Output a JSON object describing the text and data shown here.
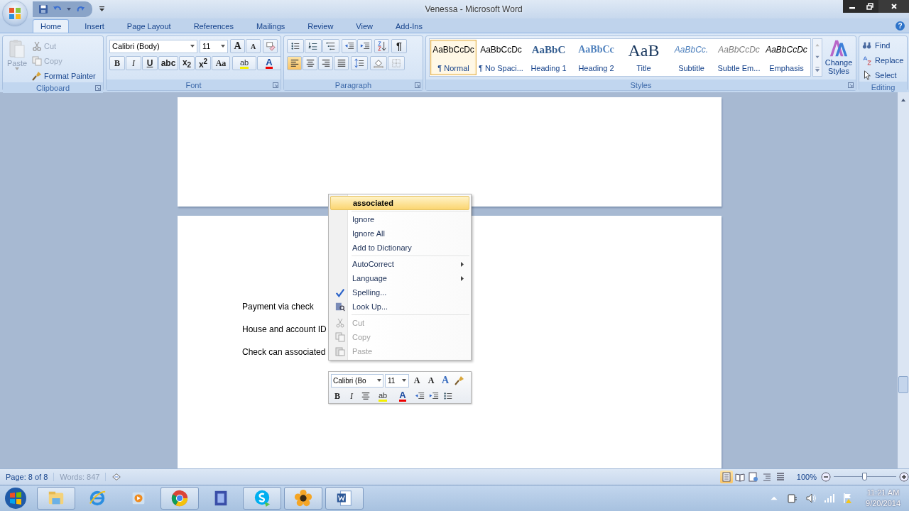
{
  "window": {
    "title": "Venessa - Microsoft Word"
  },
  "tabs": [
    {
      "label": "Home",
      "selected": true
    },
    {
      "label": "Insert",
      "selected": false
    },
    {
      "label": "Page Layout",
      "selected": false
    },
    {
      "label": "References",
      "selected": false
    },
    {
      "label": "Mailings",
      "selected": false
    },
    {
      "label": "Review",
      "selected": false
    },
    {
      "label": "View",
      "selected": false
    },
    {
      "label": "Add-Ins",
      "selected": false
    }
  ],
  "help": "?",
  "clipboard": {
    "label": "Clipboard",
    "paste": {
      "label": "Paste",
      "disabled": true
    },
    "items": [
      {
        "kind": "cut",
        "label": "Cut",
        "disabled": true
      },
      {
        "kind": "copy",
        "label": "Copy",
        "disabled": true
      },
      {
        "kind": "painter",
        "label": "Format Painter",
        "disabled": false
      }
    ]
  },
  "font": {
    "label": "Font",
    "name": "Calibri (Body)",
    "size": "11",
    "grow": "A",
    "shrink": "A",
    "styles": [
      {
        "kind": "bold",
        "text": "B"
      },
      {
        "kind": "italic",
        "text": "I"
      },
      {
        "kind": "underline",
        "text": "U"
      },
      {
        "kind": "strike",
        "text": "abc"
      },
      {
        "kind": "sub",
        "text": "x$_{2}$"
      },
      {
        "kind": "sup",
        "text": "x$^{2}$"
      },
      {
        "kind": "case",
        "text": "Aa"
      }
    ],
    "highlight": "ab",
    "text_color_letter": "A"
  },
  "paragraph": {
    "label": "Paragraph",
    "marks": "¶",
    "alignments": [
      {
        "kind": "left",
        "selected": true
      },
      {
        "kind": "center",
        "selected": false
      },
      {
        "kind": "right",
        "selected": false
      },
      {
        "kind": "justify",
        "selected": false
      }
    ]
  },
  "styles": {
    "label": "Styles",
    "change": "Change Styles",
    "items": [
      {
        "kind": "normal",
        "sample": "AaBbCcDc",
        "name": "¶ Normal",
        "selected": true
      },
      {
        "kind": "normal",
        "sample": "AaBbCcDc",
        "name": "¶ No Spaci...",
        "selected": false
      },
      {
        "kind": "h1",
        "sample": "AaBbC",
        "name": "Heading 1",
        "selected": false
      },
      {
        "kind": "h2",
        "sample": "AaBbCc",
        "name": "Heading 2",
        "selected": false
      },
      {
        "kind": "title",
        "sample": "AaB",
        "name": "Title",
        "selected": false
      },
      {
        "kind": "subtitle",
        "sample": "AaBbCc.",
        "name": "Subtitle",
        "selected": false
      },
      {
        "kind": "subtle",
        "sample": "AaBbCcDc",
        "name": "Subtle Em...",
        "selected": false
      },
      {
        "kind": "emphasis",
        "sample": "AaBbCcDc",
        "name": "Emphasis",
        "selected": false
      }
    ]
  },
  "editing": {
    "label": "Editing",
    "items": [
      {
        "kind": "find",
        "label": "Find"
      },
      {
        "kind": "replace",
        "label": "Replace"
      },
      {
        "kind": "select",
        "label": "Select"
      }
    ]
  },
  "document": {
    "lines": [
      "Payment via check",
      "House and account ID",
      "Check can associated"
    ]
  },
  "context_menu": {
    "items": [
      {
        "kind": "suggestion",
        "label": "associated",
        "disabled": false
      },
      {
        "kind": "separator"
      },
      {
        "kind": "plain",
        "label": "Ignore",
        "disabled": false
      },
      {
        "kind": "plain",
        "label": "Ignore All",
        "disabled": false
      },
      {
        "kind": "plain",
        "label": "Add to Dictionary",
        "disabled": false
      },
      {
        "kind": "separator"
      },
      {
        "kind": "submenu",
        "label": "AutoCorrect",
        "disabled": false
      },
      {
        "kind": "submenu",
        "label": "Language",
        "disabled": false
      },
      {
        "kind": "spelling",
        "label": "Spelling...",
        "disabled": false
      },
      {
        "kind": "lookup",
        "label": "Look Up...",
        "disabled": false
      },
      {
        "kind": "separator"
      },
      {
        "kind": "cut",
        "label": "Cut",
        "disabled": true
      },
      {
        "kind": "copy",
        "label": "Copy",
        "disabled": true
      },
      {
        "kind": "paste",
        "label": "Paste",
        "disabled": true
      }
    ]
  },
  "mini_toolbar": {
    "font": "Calibri (Bo",
    "size": "11",
    "grow": "A",
    "shrink": "A",
    "styles": "A",
    "bold": "B",
    "italic": "I",
    "highlight": "ab",
    "text_color_letter": "A"
  },
  "status_bar": {
    "page": "Page: 8 of 8",
    "words": "Words: 847",
    "views": [
      {
        "kind": "print",
        "selected": true
      },
      {
        "kind": "reading",
        "selected": false
      },
      {
        "kind": "web",
        "selected": false
      },
      {
        "kind": "outline",
        "selected": false
      },
      {
        "kind": "draft",
        "selected": false
      }
    ],
    "zoom": "100%",
    "zoom_slider": {
      "level": 0.5
    }
  },
  "taskbar": {
    "time": "11:21 AM",
    "date": "9/20/2014"
  }
}
